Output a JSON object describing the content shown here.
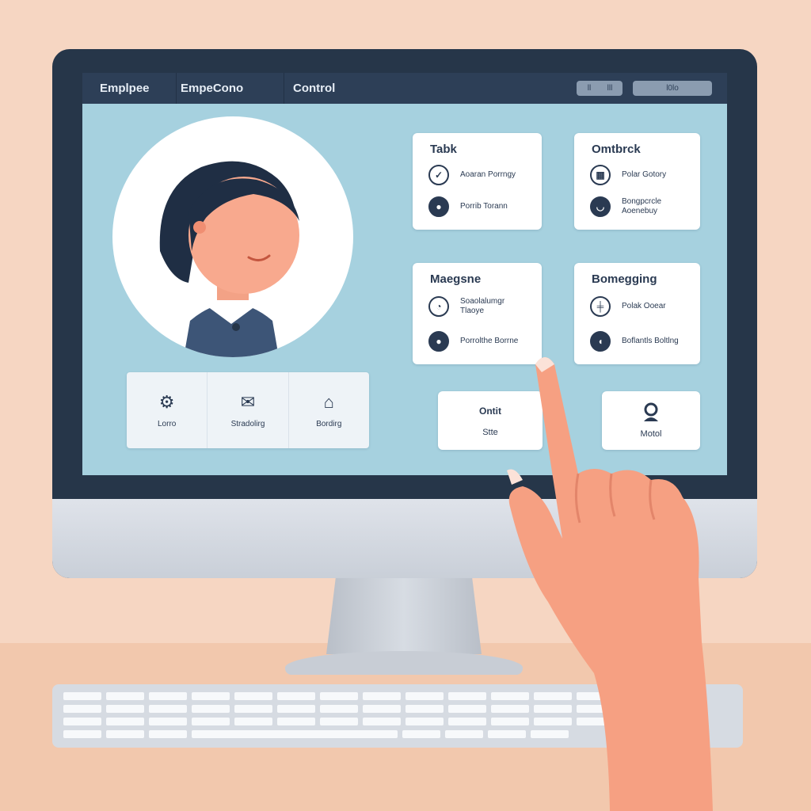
{
  "header": {
    "tabs": [
      "Emplpee",
      "EmpeCono",
      "Control"
    ],
    "pill_a": [
      "ll",
      "lll"
    ],
    "pill_b": "l0lo"
  },
  "cards": [
    {
      "title": "Tabk",
      "rows": [
        {
          "icon": "checkmark-icon",
          "glyph": "✓",
          "text": "Aoaran Porrngy"
        },
        {
          "icon": "chat-icon",
          "glyph": "●",
          "text": "Porrib Torann"
        }
      ]
    },
    {
      "title": "Omtbrck",
      "rows": [
        {
          "icon": "calendar-icon",
          "glyph": "▦",
          "text": "Polar Gotory"
        },
        {
          "icon": "people-icon",
          "glyph": "◡",
          "text": "Bongpcrcle Aoenebuy"
        }
      ]
    },
    {
      "title": "Maegsne",
      "rows": [
        {
          "icon": "clock-icon",
          "glyph": "◔",
          "text": "Soaolalumgr Tlaoye"
        },
        {
          "icon": "message-icon",
          "glyph": "●",
          "text": "Porrolthe Borrne"
        }
      ]
    },
    {
      "title": "Bomegging",
      "rows": [
        {
          "icon": "grid-icon",
          "glyph": "╪",
          "text": "Polak Ooear"
        },
        {
          "icon": "phone-icon",
          "glyph": "◖",
          "text": "Boflantls Boltlng"
        }
      ]
    }
  ],
  "toolbar": [
    {
      "icon": "gears-icon",
      "glyph": "⚙",
      "label": "Lorro"
    },
    {
      "icon": "mail-icon",
      "glyph": "✉",
      "label": "Stradolirg"
    },
    {
      "icon": "building-icon",
      "glyph": "⌂",
      "label": "Bordirg"
    }
  ],
  "small_cards": [
    {
      "title": "Ontit",
      "label": "Stte"
    },
    {
      "icon": "person-icon",
      "label": "Motol"
    }
  ],
  "colors": {
    "screen_bg": "#a6d1df",
    "topbar": "#2d3f57",
    "text": "#2a3a52"
  }
}
